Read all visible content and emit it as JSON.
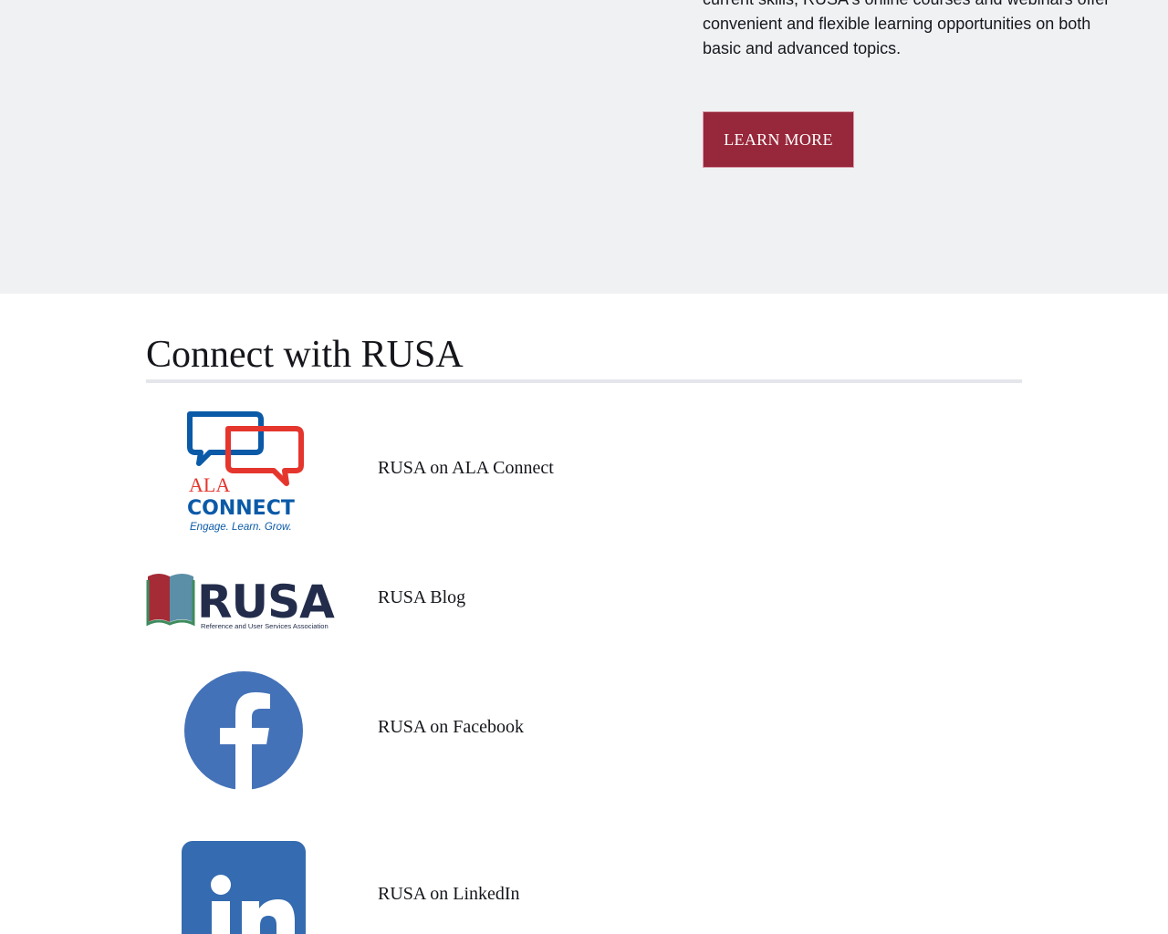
{
  "promo": {
    "text_line1": "current skills, RUSA's online courses and webinars offer",
    "text_line2": "convenient and flexible learning opportunities on both",
    "text_line3": "basic and advanced topics.",
    "button_label": "LEARN MORE"
  },
  "connect": {
    "title": "Connect with RUSA",
    "items": [
      {
        "label": "RUSA on ALA Connect",
        "logo_icon": "ala-connect-logo",
        "logo_text_1": "ALA",
        "logo_text_2": "CONNECT",
        "logo_tagline": "Engage. Learn. Grow."
      },
      {
        "label": "RUSA Blog",
        "logo_icon": "rusa-logo",
        "logo_text": "RUSA",
        "logo_subtitle": "Reference and User Services Association"
      },
      {
        "label": "RUSA on Facebook",
        "logo_icon": "facebook-icon",
        "logo_glyph": "f"
      },
      {
        "label": "RUSA on LinkedIn",
        "logo_icon": "linkedin-icon",
        "logo_glyph": "in"
      }
    ]
  },
  "colors": {
    "accent_button": "#97273a",
    "facebook_blue": "#4472b8",
    "linkedin_blue": "#356bb0",
    "ala_red": "#e5362e",
    "ala_blue": "#0a5aa8",
    "rusa_navy": "#232d4b"
  }
}
